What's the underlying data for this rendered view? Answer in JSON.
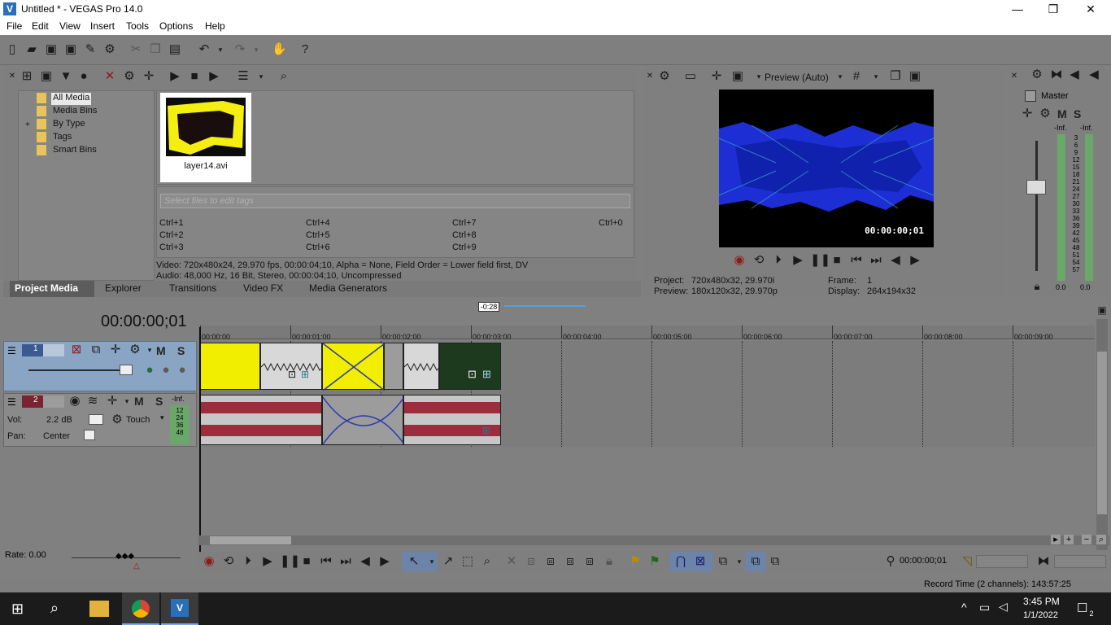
{
  "window": {
    "title": "Untitled * - VEGAS Pro 14.0",
    "min": "—",
    "max": "❐",
    "close": "✕"
  },
  "menu": [
    "File",
    "Edit",
    "View",
    "Insert",
    "Tools",
    "Options",
    "Help"
  ],
  "media": {
    "tree": [
      "All Media",
      "Media Bins",
      "By Type",
      "Tags",
      "Smart Bins"
    ],
    "expander": "+",
    "file": "layer14.avi",
    "tags_placeholder": "Select files to edit tags",
    "shortcuts": [
      "Ctrl+1",
      "Ctrl+2",
      "Ctrl+3",
      "Ctrl+4",
      "Ctrl+5",
      "Ctrl+6",
      "Ctrl+7",
      "Ctrl+8",
      "Ctrl+9",
      "Ctrl+0"
    ],
    "video_info": "Video: 720x480x24, 29.970 fps, 00:00:04;10, Alpha = None, Field Order = Lower field first, DV",
    "audio_info": "Audio: 48,000 Hz, 16 Bit, Stereo, 00:00:04;10, Uncompressed",
    "tabs": [
      "Project Media",
      "Explorer",
      "Transitions",
      "Video FX",
      "Media Generators"
    ]
  },
  "preview": {
    "mode": "Preview (Auto)",
    "overlay_timecode": "00:00:00;01",
    "project_label": "Project:",
    "project_value": "720x480x32, 29.970i",
    "preview_label": "Preview:",
    "preview_value": "180x120x32, 29.970p",
    "frame_label": "Frame:",
    "frame_value": "1",
    "display_label": "Display:",
    "display_value": "264x194x32"
  },
  "master": {
    "title": "Master",
    "m": "M",
    "s": "S",
    "inf_left": "-Inf.",
    "inf_right": "-Inf.",
    "scale": [
      "3",
      "6",
      "9",
      "12",
      "15",
      "18",
      "21",
      "24",
      "27",
      "30",
      "33",
      "36",
      "39",
      "42",
      "45",
      "48",
      "51",
      "54",
      "57"
    ],
    "bottom_left": "0.0",
    "bottom_right": "0.0"
  },
  "timeline": {
    "timecode": "00:00:00;01",
    "loop_badge": "-0:28",
    "ruler": [
      "00:00:00",
      "00:00:01:00",
      "00:00:02:00",
      "00:00:03:00",
      "00:00:04:00",
      "00:00:05:00",
      "00:00:06:00",
      "00:00:07:00",
      "00:00:08:00",
      "00:00:09:00"
    ],
    "track1": {
      "number": "1",
      "m": "M",
      "s": "S"
    },
    "track2": {
      "number": "2",
      "m": "M",
      "s": "S",
      "inf": "-Inf.",
      "vol_label": "Vol:",
      "vol_value": "2.2 dB",
      "automation": "Touch",
      "pan_label": "Pan:",
      "pan_value": "Center",
      "meter": [
        "12",
        "24",
        "36",
        "48"
      ]
    },
    "rate": "Rate: 0.00",
    "cursor_time": "00:00:00;01"
  },
  "status": {
    "record_time": "Record Time (2 channels): 143:57:25"
  },
  "taskbar": {
    "time": "3:45 PM",
    "date": "1/1/2022",
    "notification_count": "2"
  },
  "colors": {
    "clip_yellow": "#f2ee00",
    "audio_wave": "#9b2d3d",
    "track1_header": "#8aa4c4",
    "panel_gray": "#7f7f7f"
  }
}
